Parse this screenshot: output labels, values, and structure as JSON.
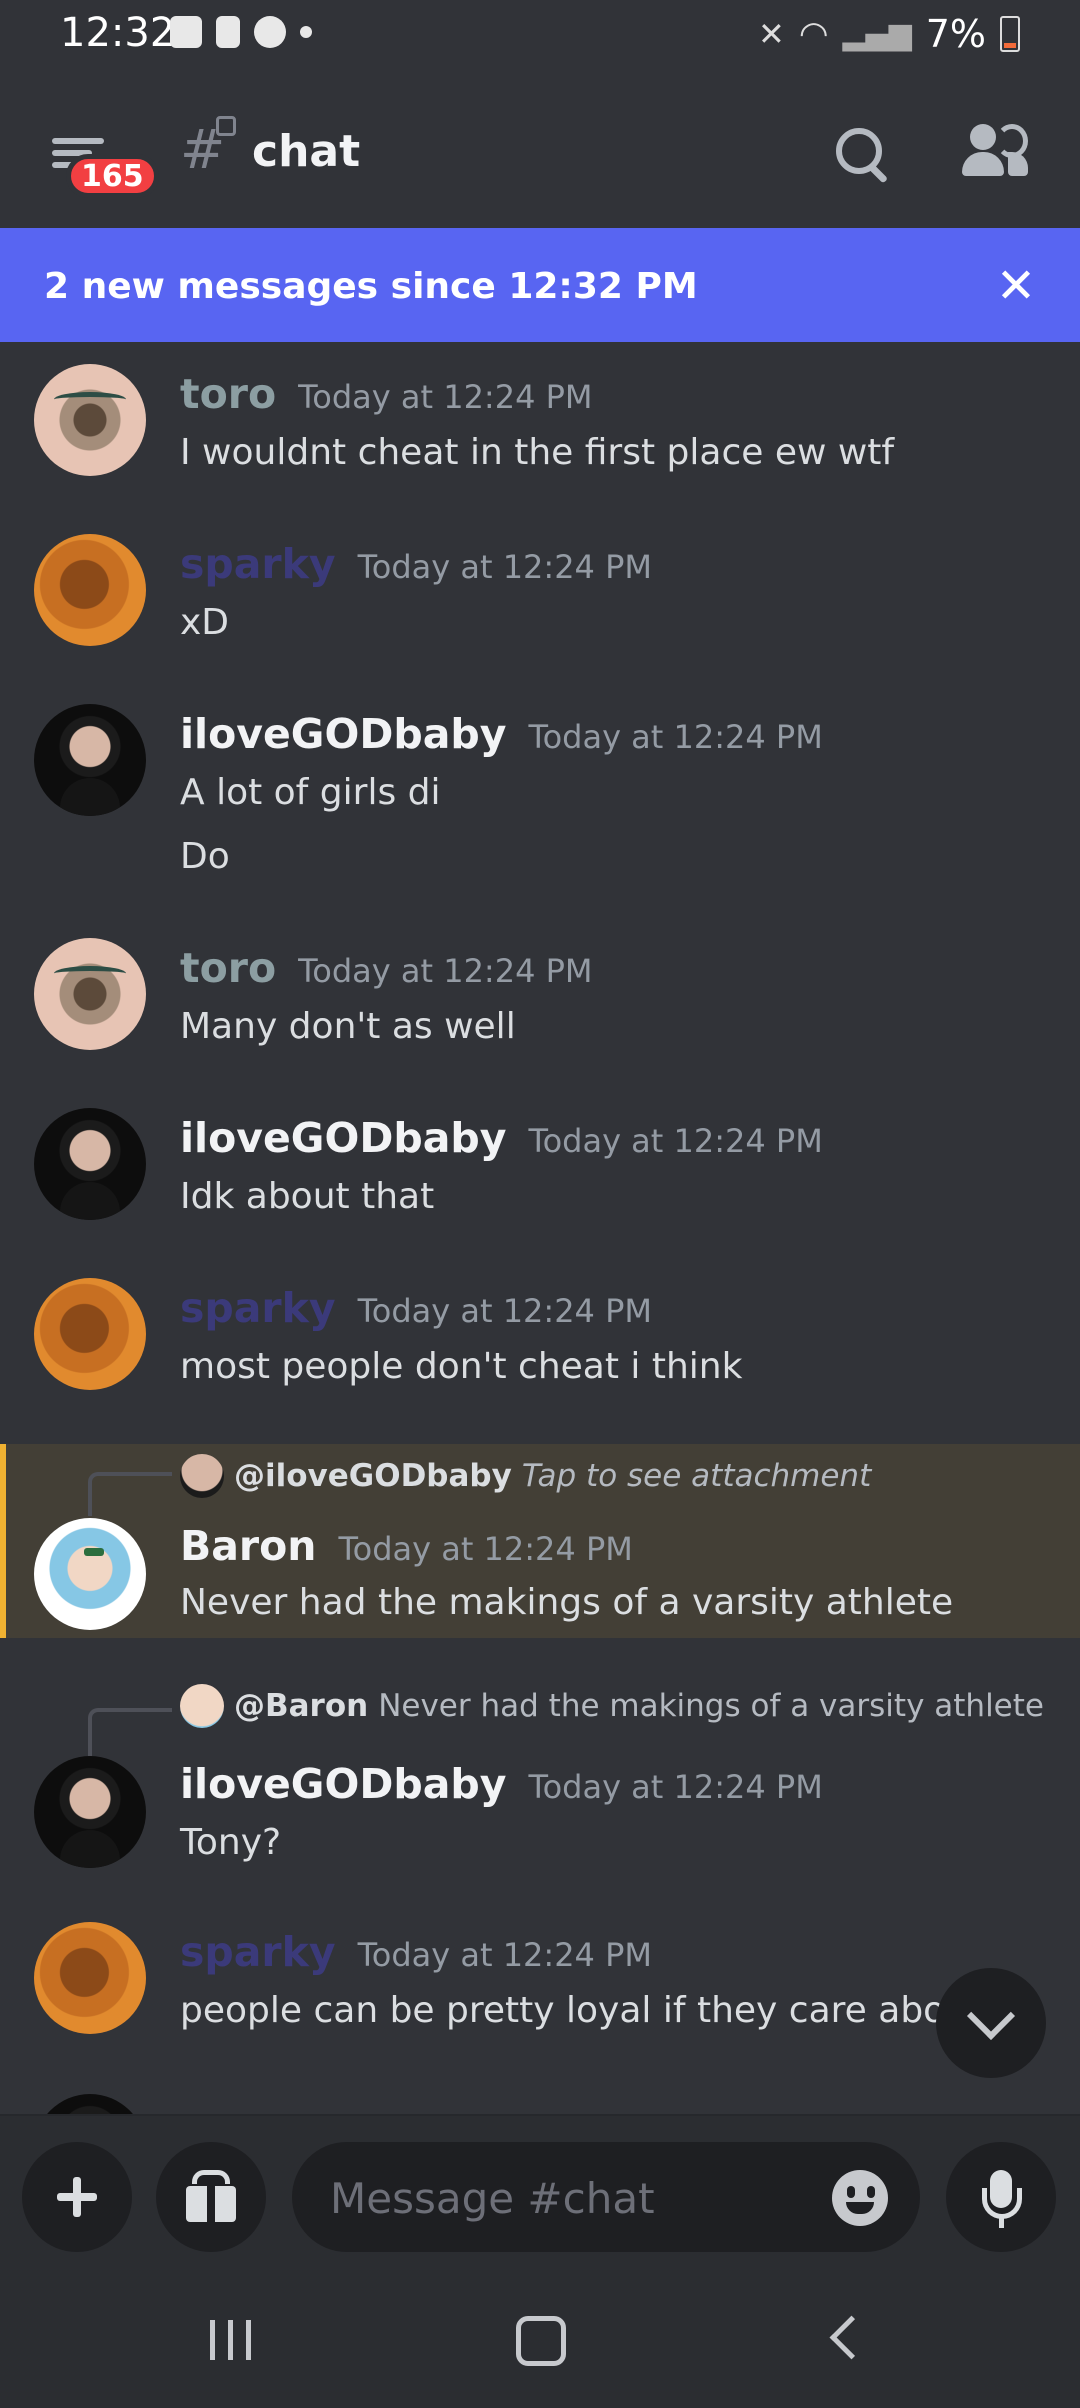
{
  "status_bar": {
    "time": "12:32",
    "battery": "7%",
    "icons": [
      "gallery-icon",
      "alert-icon",
      "messenger-icon",
      "dot-icon",
      "mute-icon",
      "wifi-icon",
      "signal-icon",
      "battery-icon"
    ]
  },
  "header": {
    "badge_count": "165",
    "channel_name": "chat"
  },
  "new_messages_bar": {
    "text": "2 new messages since 12:32 PM"
  },
  "messages": [
    {
      "username": "toro",
      "timestamp": "Today at 12:24 PM",
      "lines": [
        "I wouldnt cheat in the first place ew wtf"
      ]
    },
    {
      "username": "sparky",
      "timestamp": "Today at 12:24 PM",
      "lines": [
        "xD"
      ]
    },
    {
      "username": "iloveGODbaby",
      "timestamp": "Today at 12:24 PM",
      "lines": [
        "A lot of girls di",
        "Do"
      ]
    },
    {
      "username": "toro",
      "timestamp": "Today at 12:24 PM",
      "lines": [
        "Many don't as well"
      ]
    },
    {
      "username": "iloveGODbaby",
      "timestamp": "Today at 12:24 PM",
      "lines": [
        "Idk about that"
      ]
    },
    {
      "username": "sparky",
      "timestamp": "Today at 12:24 PM",
      "lines": [
        "most people don't cheat i think"
      ]
    },
    {
      "username": "Baron",
      "timestamp": "Today at 12:24 PM",
      "lines": [
        "Never had the makings of a varsity athlete"
      ],
      "reply": {
        "mention": "@iloveGODbaby",
        "preview": "Tap to see attachment"
      }
    },
    {
      "username": "iloveGODbaby",
      "timestamp": "Today at 12:24 PM",
      "lines": [
        "Tony?"
      ],
      "reply": {
        "mention": "@Baron",
        "preview": "Never had the makings of a varsity athlete"
      }
    },
    {
      "username": "sparky",
      "timestamp": "Today at 12:24 PM",
      "lines": [
        "people can be pretty loyal if they care about y"
      ]
    }
  ],
  "composer": {
    "placeholder": "Message #chat"
  },
  "colors": {
    "background": "#313338",
    "accent": "#5865f2",
    "mention_highlight": "#433f36",
    "mention_bar": "#f0b232",
    "badge": "#f23f42"
  }
}
